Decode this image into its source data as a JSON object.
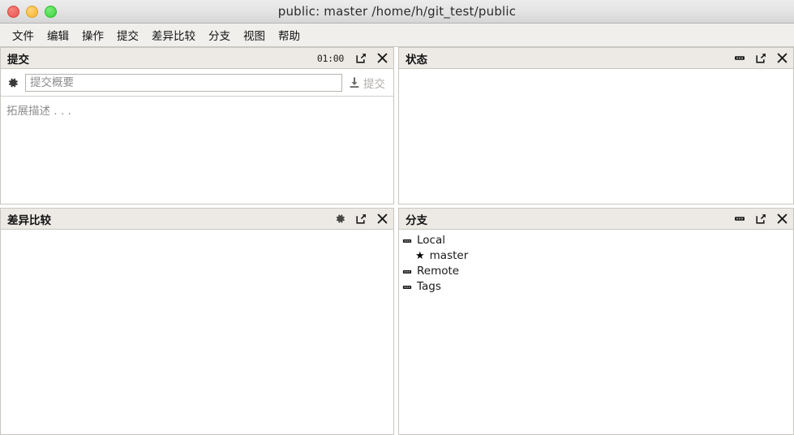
{
  "window": {
    "title": "public: master /home/h/git_test/public",
    "traffic_lights": [
      {
        "name": "close",
        "color": "#e9544f"
      },
      {
        "name": "minimize",
        "color": "#f5b429"
      },
      {
        "name": "zoom",
        "color": "#38d338"
      }
    ]
  },
  "menubar": {
    "items": [
      {
        "label": "文件"
      },
      {
        "label": "编辑"
      },
      {
        "label": "操作"
      },
      {
        "label": "提交"
      },
      {
        "label": "差异比较"
      },
      {
        "label": "分支"
      },
      {
        "label": "视图"
      },
      {
        "label": "帮助"
      }
    ]
  },
  "panels": {
    "commit": {
      "title": "提交",
      "timer": "01:00",
      "tools": [
        "expand-icon",
        "close-icon"
      ],
      "options_icon": "gear-icon",
      "summary_placeholder": "提交概要",
      "summary_value": "",
      "description_placeholder": "拓展描述 . . .",
      "description_value": "",
      "commit_button_label": "提交",
      "commit_button_icon": "commit-arrow-icon",
      "commit_button_enabled": false
    },
    "status": {
      "title": "状态",
      "tools": [
        "more-icon",
        "expand-icon",
        "close-icon"
      ],
      "items": []
    },
    "diff": {
      "title": "差异比较",
      "tools": [
        "gear-icon",
        "expand-icon",
        "close-icon"
      ],
      "content": ""
    },
    "branches": {
      "title": "分支",
      "tools": [
        "more-icon",
        "expand-icon",
        "close-icon"
      ],
      "tree": [
        {
          "label": "Local",
          "icon": "group-icon",
          "level": 0
        },
        {
          "label": "master",
          "icon": "star-icon",
          "level": 1
        },
        {
          "label": "Remote",
          "icon": "group-icon",
          "level": 0
        },
        {
          "label": "Tags",
          "icon": "group-icon",
          "level": 0
        }
      ]
    }
  },
  "colors": {
    "titlebar": "#e4e4e4",
    "panel_header": "#edeae5",
    "panel_border": "#c9c6c0",
    "menubar": "#f0efec",
    "body": "#ffffff",
    "placeholder": "#8d8d8d",
    "disabled_text": "#b0aeab"
  }
}
